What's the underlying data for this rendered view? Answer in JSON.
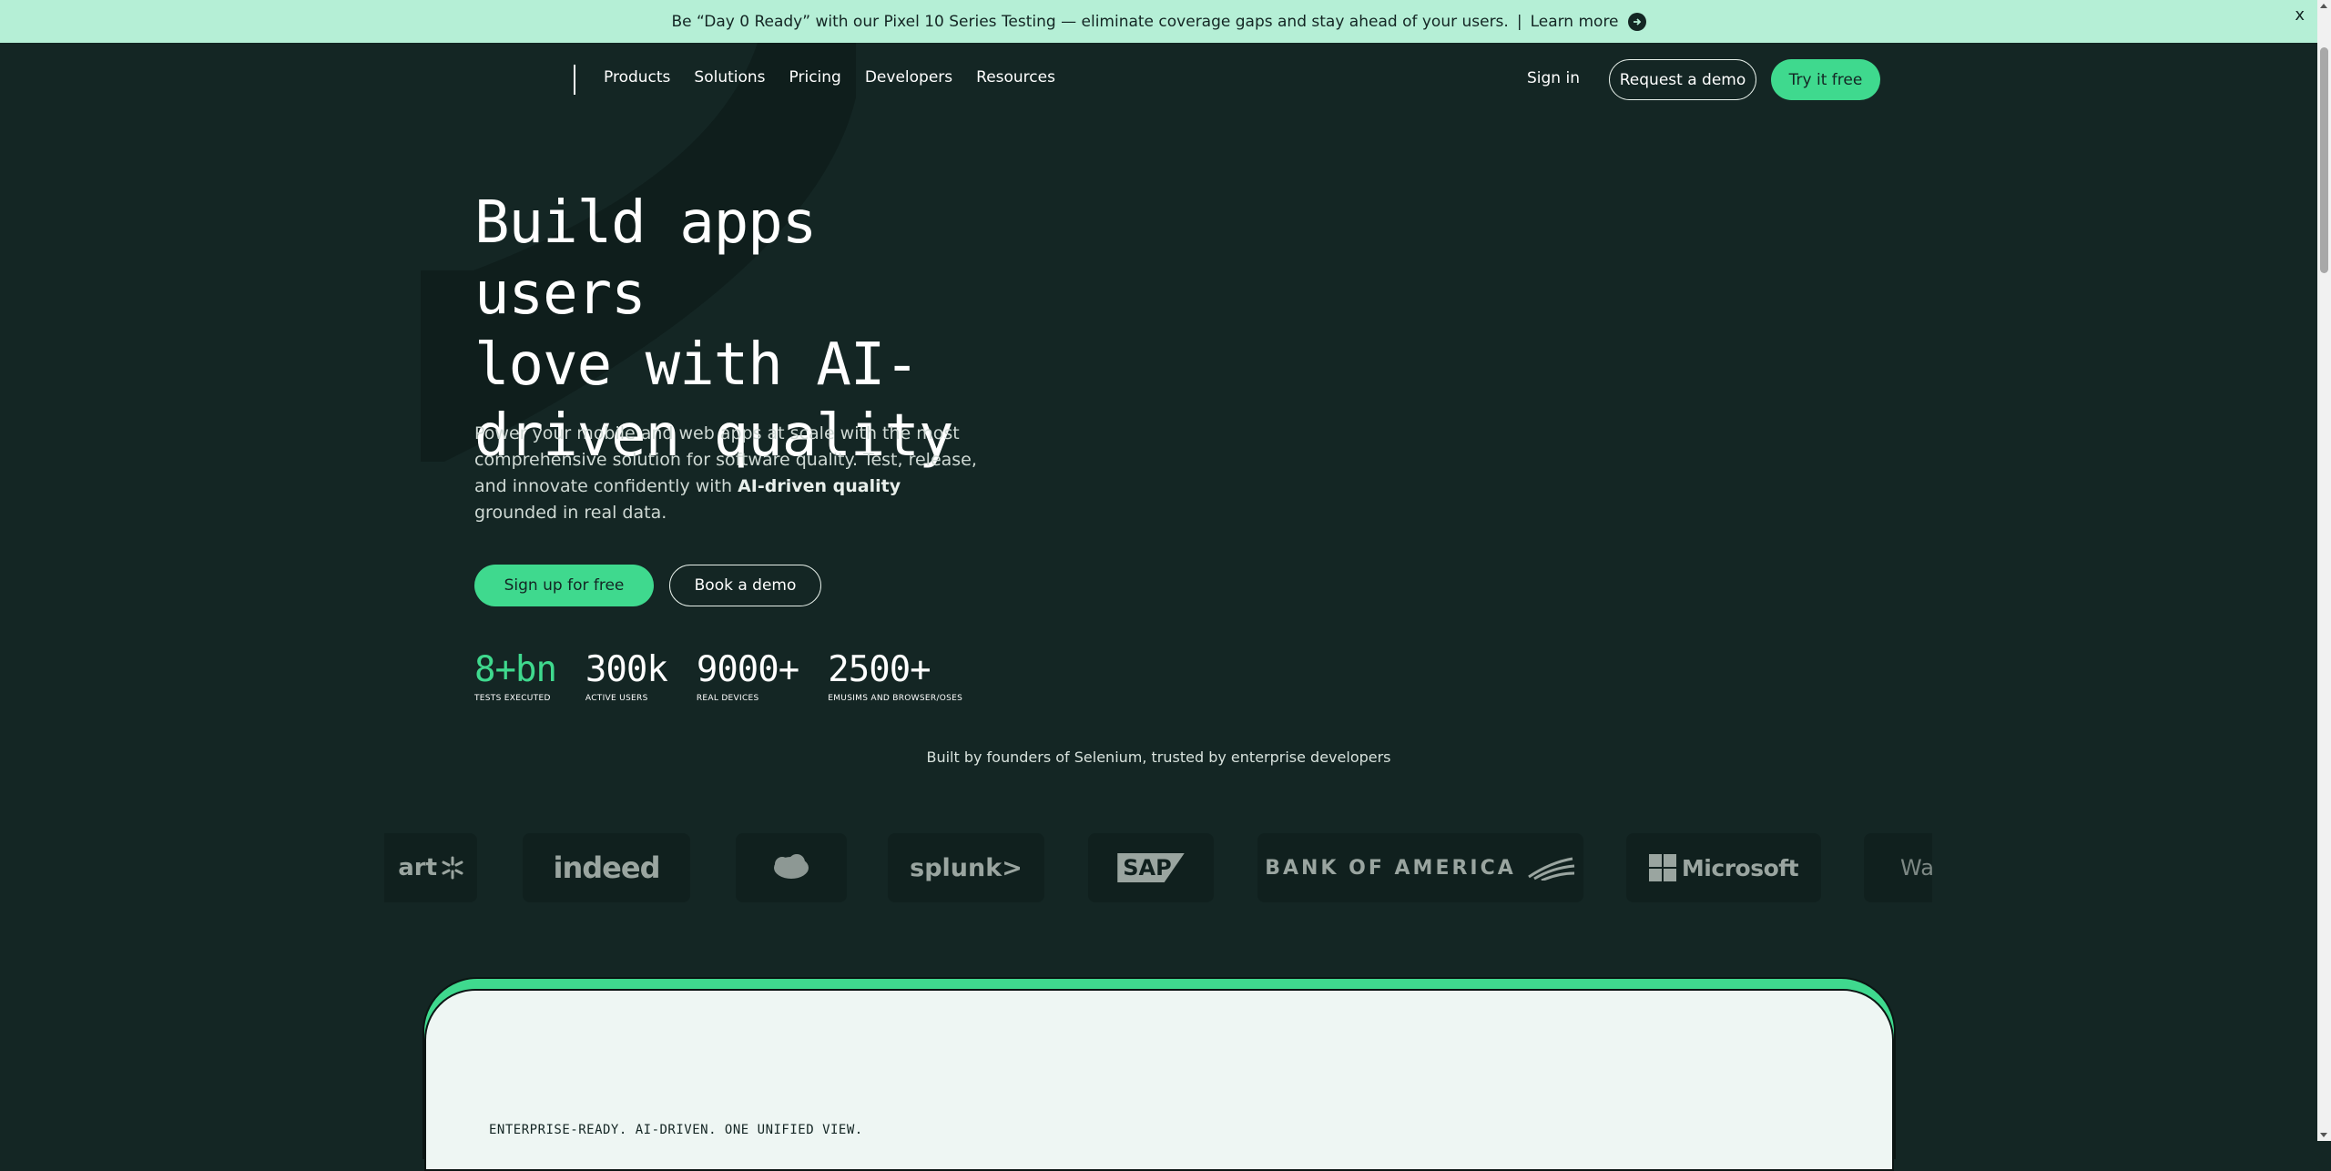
{
  "banner": {
    "text": "Be “Day 0 Ready” with our Pixel 10 Series Testing — eliminate coverage gaps and stay ahead of your users.",
    "separator": "|",
    "link": "Learn more",
    "close": "x"
  },
  "nav": {
    "items": [
      {
        "label": "Products"
      },
      {
        "label": "Solutions"
      },
      {
        "label": "Pricing"
      },
      {
        "label": "Developers"
      },
      {
        "label": "Resources"
      }
    ],
    "sign_in": "Sign in",
    "request_demo": "Request a demo",
    "try_free": "Try it free"
  },
  "hero": {
    "title_lines": [
      "Build apps users",
      "love with AI-",
      "driven quality"
    ],
    "desc_before": "Power your mobile and web apps at scale with the most comprehensive solution for software quality. Test, release, and innovate confidently with",
    "desc_bold": "AI-driven quality",
    "desc_after": "grounded in real data.",
    "cta_primary": "Sign up for free",
    "cta_secondary": "Book a demo"
  },
  "stats": [
    {
      "value": "8+bn",
      "label": "TESTS EXECUTED"
    },
    {
      "value": "300k",
      "label": "ACTIVE USERS"
    },
    {
      "value": "9000+",
      "label": "REAL DEVICES"
    },
    {
      "value": "2500+",
      "label": "EMUSIMS AND BROWSER/OSES"
    }
  ],
  "trusted_text": "Built by founders of Selenium, trusted by enterprise developers",
  "logos": [
    {
      "name": "walmart-partial",
      "text": "art"
    },
    {
      "name": "indeed",
      "text": "indeed"
    },
    {
      "name": "salesforce",
      "text": "salesforce"
    },
    {
      "name": "splunk",
      "text": "splunk>"
    },
    {
      "name": "sap",
      "text": "SAP"
    },
    {
      "name": "bank-of-america",
      "text": "BANK OF AMERICA"
    },
    {
      "name": "microsoft",
      "text": "Microsoft"
    },
    {
      "name": "walmart-partial-right",
      "text": "Wal"
    }
  ],
  "section": {
    "eyebrow": "ENTERPRISE-READY. AI-DRIVEN. ONE UNIFIED VIEW."
  },
  "colors": {
    "background": "#142624",
    "banner": "#b5efd6",
    "accent": "#3fd98e",
    "card": "#eef6f3"
  }
}
